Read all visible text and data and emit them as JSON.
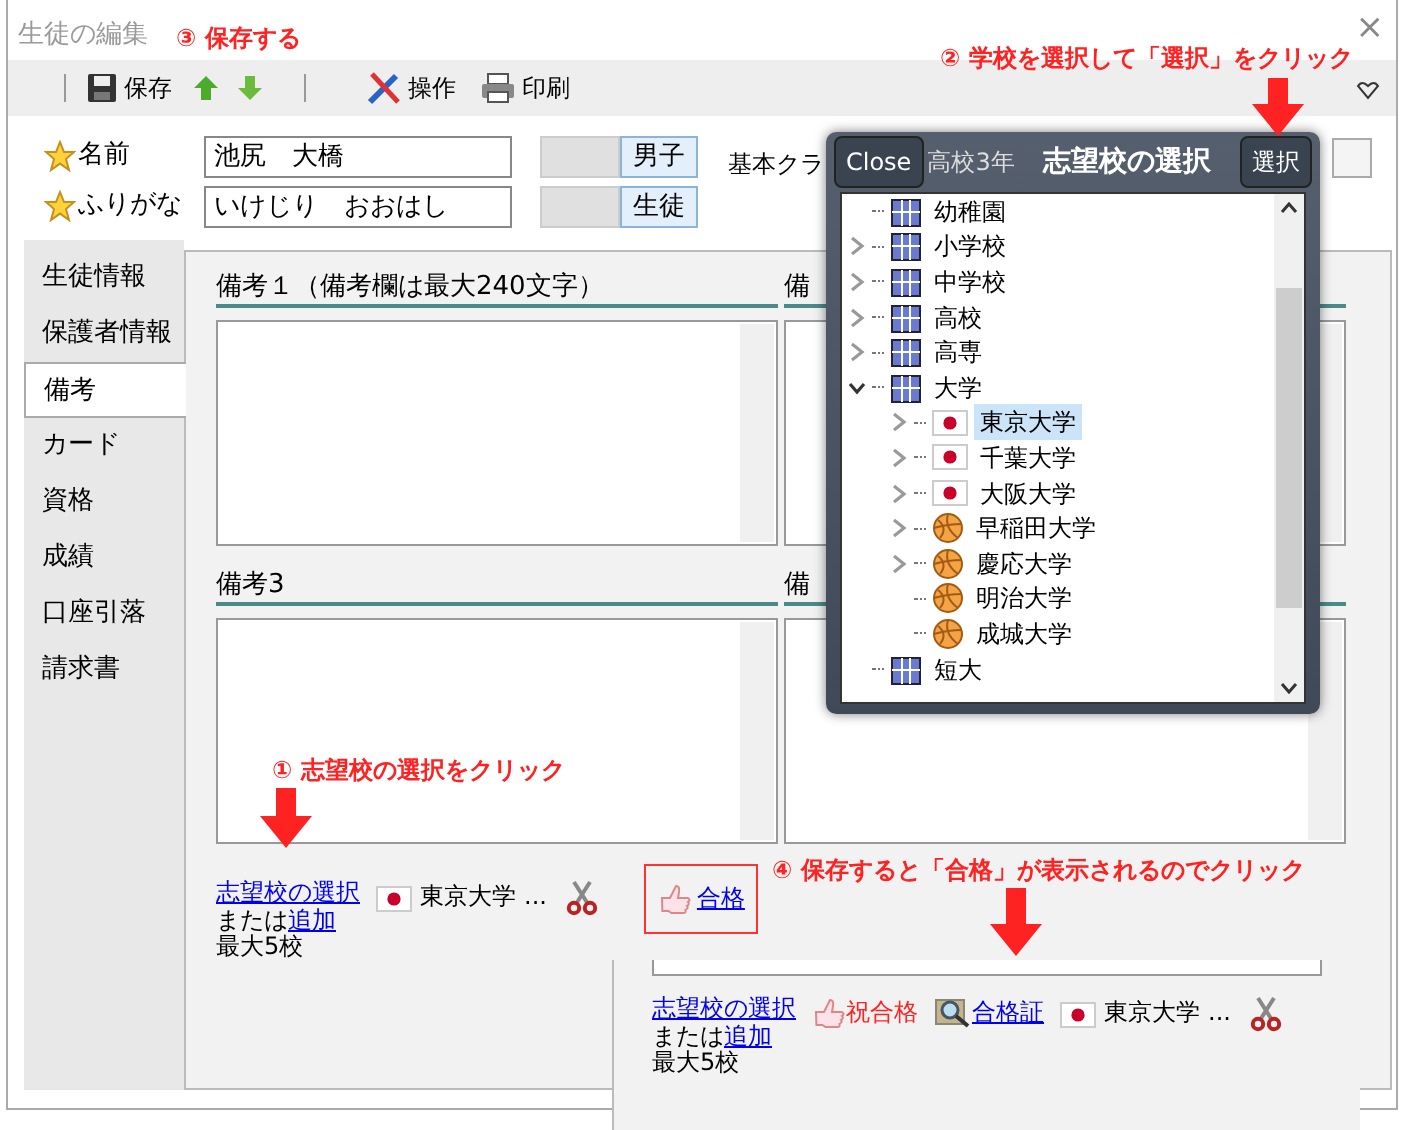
{
  "window": {
    "title": "生徒の編集",
    "close": "×"
  },
  "toolbar": [
    {
      "kind": "save",
      "label": "保存"
    },
    {
      "kind": "up"
    },
    {
      "kind": "down"
    },
    {
      "kind": "separator"
    },
    {
      "kind": "tools",
      "label": "操作"
    },
    {
      "kind": "print",
      "label": "印刷"
    }
  ],
  "header_fields": [
    {
      "label": "名前",
      "value": "池尻　大橋",
      "tag": "男子"
    },
    {
      "label": "ふりがな",
      "value": "いけじり　おおはし",
      "tag": "生徒"
    }
  ],
  "class_field": {
    "label": "基本クラ",
    "value": "高校3年"
  },
  "side_tabs": [
    {
      "label": "生徒情報",
      "selected": false
    },
    {
      "label": "保護者情報",
      "selected": false
    },
    {
      "label": "備考",
      "selected": true
    },
    {
      "label": "カード",
      "selected": false
    },
    {
      "label": "資格",
      "selected": false
    },
    {
      "label": "成績",
      "selected": false
    },
    {
      "label": "口座引落",
      "selected": false
    },
    {
      "label": "請求書",
      "selected": false
    }
  ],
  "notes": [
    {
      "label": "備考１（備考欄は最大240文字）"
    },
    {
      "label": "備"
    },
    {
      "label": "備考3"
    },
    {
      "label": "備"
    }
  ],
  "school_choice": {
    "select_link": "志望校の選択",
    "or_text": "または",
    "add_link": "追加",
    "max_text": "最大5校",
    "school": "東京大学",
    "more": "...",
    "pass_link": "合格"
  },
  "result_preview": {
    "select_link": "志望校の選択",
    "or_text": "または",
    "add_link": "追加",
    "max_text": "最大5校",
    "congrats": "祝合格",
    "certificate_link": "合格証",
    "school": "東京大学",
    "more": "..."
  },
  "popup": {
    "close": "Close",
    "title": "志望校の選択",
    "select": "選択",
    "tree": [
      {
        "label": "幼稚園",
        "kind": "building",
        "expandable": false,
        "selected": false
      },
      {
        "label": "小学校",
        "kind": "building",
        "expandable": true,
        "expanded": false,
        "selected": false
      },
      {
        "label": "中学校",
        "kind": "building",
        "expandable": true,
        "expanded": false,
        "selected": false
      },
      {
        "label": "高校",
        "kind": "building",
        "expandable": true,
        "expanded": false,
        "selected": false
      },
      {
        "label": "高専",
        "kind": "building",
        "expandable": true,
        "expanded": false,
        "selected": false
      },
      {
        "label": "大学",
        "kind": "building",
        "expandable": true,
        "expanded": true,
        "selected": false,
        "children": [
          {
            "label": "東京大学",
            "kind": "flag",
            "expandable": true,
            "expanded": false,
            "selected": true
          },
          {
            "label": "千葉大学",
            "kind": "flag",
            "expandable": true,
            "expanded": false,
            "selected": false
          },
          {
            "label": "大阪大学",
            "kind": "flag",
            "expandable": true,
            "expanded": false,
            "selected": false
          },
          {
            "label": "早稲田大学",
            "kind": "ball",
            "expandable": true,
            "expanded": false,
            "selected": false
          },
          {
            "label": "慶応大学",
            "kind": "ball",
            "expandable": true,
            "expanded": false,
            "selected": false
          },
          {
            "label": "明治大学",
            "kind": "ball",
            "expandable": false,
            "selected": false
          },
          {
            "label": "成城大学",
            "kind": "ball",
            "expandable": false,
            "selected": false
          }
        ]
      },
      {
        "label": "短大",
        "kind": "building",
        "expandable": false,
        "selected": false
      }
    ]
  },
  "annotations": [
    {
      "text": "③ 保存する",
      "arrow": false
    },
    {
      "text": "② 学校を選択して「選択」をクリック",
      "arrow": true
    },
    {
      "text": "① 志望校の選択をクリック",
      "arrow": true
    },
    {
      "text": "④ 保存すると「合格」が表示されるのでクリック",
      "arrow": true
    }
  ]
}
